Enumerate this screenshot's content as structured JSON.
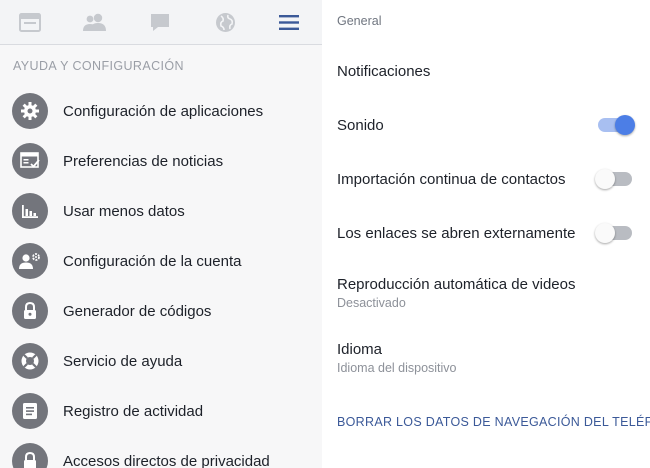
{
  "tabs": [
    {
      "icon": "news-feed-icon"
    },
    {
      "icon": "friends-icon"
    },
    {
      "icon": "messages-icon"
    },
    {
      "icon": "globe-icon"
    },
    {
      "icon": "hamburger-menu-icon"
    }
  ],
  "colors": {
    "accent": "#3b5998",
    "toggle_on": "#4c7ee6",
    "icon_circle": "#73757c",
    "link": "#3b5998"
  },
  "left": {
    "section_header": "AYUDA Y CONFIGURACIÓN",
    "items": [
      {
        "label": "Configuración de aplicaciones",
        "icon": "gear-icon"
      },
      {
        "label": "Preferencias de noticias",
        "icon": "news-preferences-icon"
      },
      {
        "label": "Usar menos datos",
        "icon": "bar-chart-icon"
      },
      {
        "label": "Configuración de la cuenta",
        "icon": "account-settings-icon"
      },
      {
        "label": "Generador de códigos",
        "icon": "lock-icon"
      },
      {
        "label": "Servicio de ayuda",
        "icon": "lifebuoy-icon"
      },
      {
        "label": "Registro de actividad",
        "icon": "activity-log-icon"
      },
      {
        "label": "Accesos directos de privacidad",
        "icon": "privacy-lock-icon"
      }
    ]
  },
  "right": {
    "section": "General",
    "notifications": "Notificaciones",
    "sound": {
      "label": "Sonido",
      "enabled": true
    },
    "contacts_import": {
      "label": "Importación continua de contactos",
      "enabled": false
    },
    "external_links": {
      "label": "Los enlaces se abren externamente",
      "enabled": false
    },
    "autoplay": {
      "label": "Reproducción automática de videos",
      "value": "Desactivado"
    },
    "language": {
      "label": "Idioma",
      "value": "Idioma del dispositivo"
    },
    "clear_data": "BORRAR LOS DATOS DE NAVEGACIÓN DEL TELÉF.."
  }
}
